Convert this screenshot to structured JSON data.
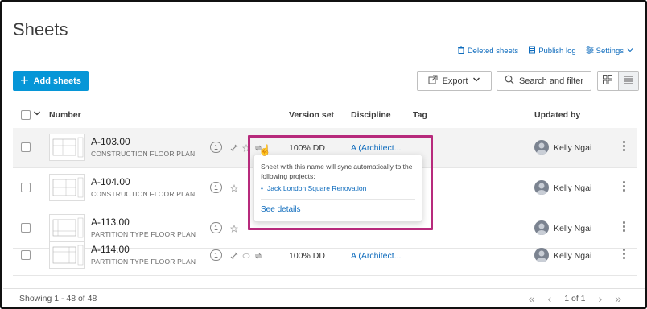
{
  "page": {
    "title": "Sheets"
  },
  "top_links": [
    {
      "label": "Deleted sheets",
      "icon": "trash-icon"
    },
    {
      "label": "Publish log",
      "icon": "publish-log-icon"
    },
    {
      "label": "Settings",
      "icon": "settings-sliders-icon"
    }
  ],
  "toolbar": {
    "add_label": "Add sheets",
    "export_label": "Export",
    "search_label": "Search and filter"
  },
  "table": {
    "headers": {
      "number": "Number",
      "version": "Version set",
      "discipline": "Discipline",
      "tag": "Tag",
      "updated": "Updated by"
    },
    "rows": [
      {
        "number": "A-103.00",
        "title": "CONSTRUCTION FLOOR PLAN",
        "count": "1",
        "version": "100% DD",
        "discipline": "A (Architect...",
        "user": "Kelly Ngai"
      },
      {
        "number": "A-104.00",
        "title": "CONSTRUCTION FLOOR PLAN",
        "count": "1",
        "version": "",
        "discipline": "",
        "user": "Kelly Ngai"
      },
      {
        "number": "A-113.00",
        "title": "PARTITION TYPE FLOOR PLAN",
        "count": "1",
        "version": "",
        "discipline": "",
        "user": "Kelly Ngai"
      },
      {
        "number": "A-114.00",
        "title": "PARTITION TYPE FLOOR PLAN",
        "count": "1",
        "version": "100% DD",
        "discipline": "A (Architect...",
        "user": "Kelly Ngai"
      }
    ]
  },
  "popover": {
    "message": "Sheet with this name will sync automatically to the following projects:",
    "project": "Jack London Square Renovation",
    "details": "See details"
  },
  "footer": {
    "showing": "Showing 1 - 48 of 48",
    "page_info": "1 of 1"
  },
  "colors": {
    "accent": "#0696d7",
    "link": "#0f6cbd",
    "highlight_frame": "#b72a7c"
  }
}
